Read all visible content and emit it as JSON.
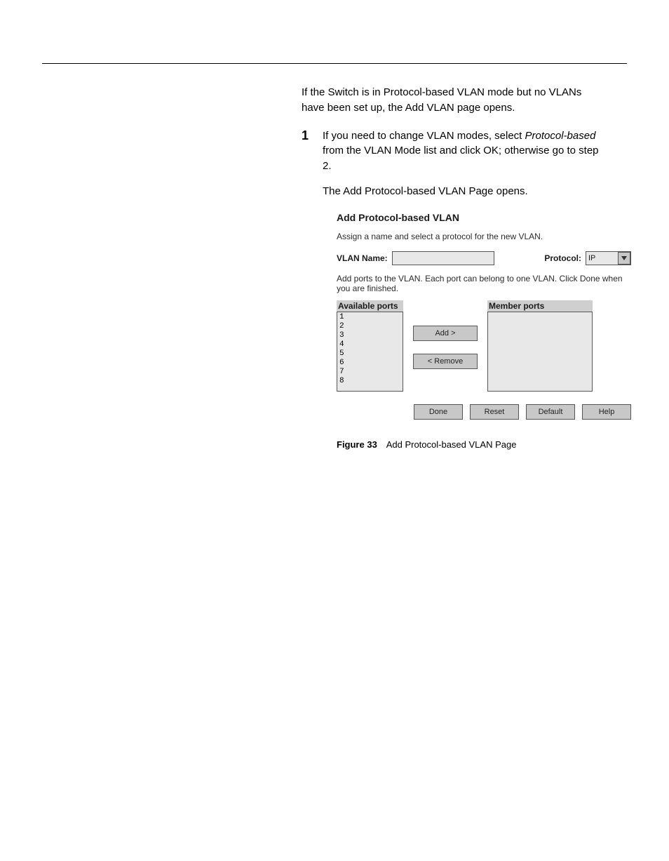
{
  "header": {
    "left": "",
    "right": ""
  },
  "intro": "If the Switch is in Protocol-based VLAN mode but no VLANs have been set up, the Add VLAN page opens.",
  "steps": {
    "s1_num": "1",
    "s1_text_a": "If you need to change VLAN modes, select ",
    "s1_text_b": " from the VLAN Mode list and click OK; otherwise go to step 2.",
    "s1_em": "Protocol-based",
    "s1_text2": "The Add Protocol-based VLAN Page opens."
  },
  "dialog": {
    "title": "Add Protocol-based VLAN",
    "desc": "Assign a name and select a protocol for the new VLAN.",
    "vlan_name_label": "VLAN Name:",
    "vlan_name_value": "",
    "protocol_label": "Protocol:",
    "protocol_value": "IP",
    "instr": "Add ports to the VLAN. Each port can belong to one VLAN. Click Done when you are finished.",
    "available_header": "Available ports",
    "member_header": "Member ports",
    "available_ports": [
      "1",
      "2",
      "3",
      "4",
      "5",
      "6",
      "7",
      "8"
    ],
    "member_ports": [],
    "add_btn": "Add   >",
    "remove_btn": "< Remove",
    "done_btn": "Done",
    "reset_btn": "Reset",
    "default_btn": "Default",
    "help_btn": "Help"
  },
  "caption": {
    "fignum": "Figure 33",
    "text": "Add Protocol-based VLAN Page"
  },
  "footer": ""
}
